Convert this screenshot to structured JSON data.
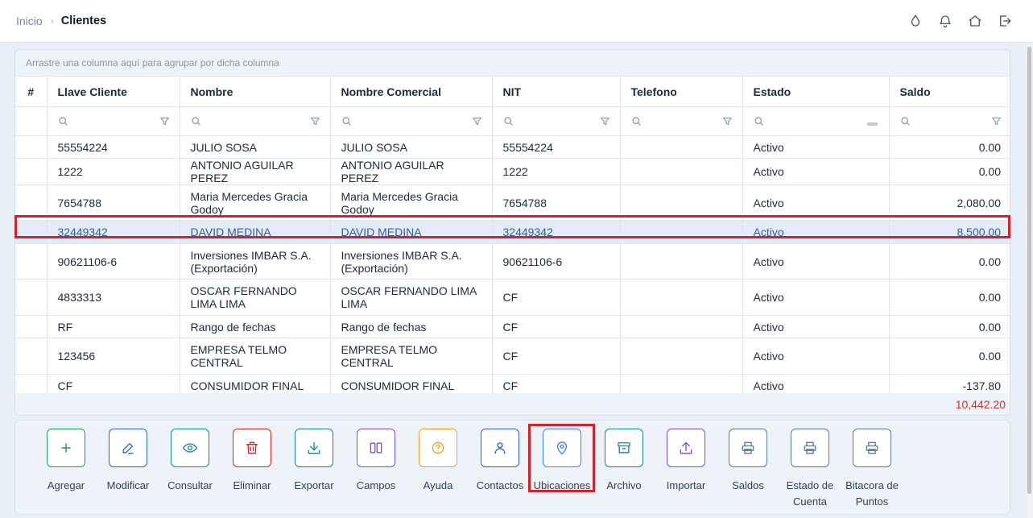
{
  "breadcrumb": {
    "home": "Inicio",
    "separator": "›",
    "current": "Clientes"
  },
  "header_icons": [
    "drop-icon",
    "bell-icon",
    "home-icon",
    "logout-icon"
  ],
  "grid": {
    "group_hint": "Arrastre una columna aquí para agrupar por dicha columna",
    "columns": [
      "#",
      "Llave Cliente",
      "Nombre",
      "Nombre Comercial",
      "NIT",
      "Telefono",
      "Estado",
      "Saldo"
    ],
    "rows": [
      {
        "llave": "55554224",
        "nombre": "JULIO SOSA",
        "comercial": "JULIO SOSA",
        "nit": "55554224",
        "telefono": "",
        "estado": "Activo",
        "saldo": "0.00"
      },
      {
        "llave": "1222",
        "nombre": "ANTONIO AGUILAR PEREZ",
        "comercial": "ANTONIO AGUILAR PEREZ",
        "nit": "1222",
        "telefono": "",
        "estado": "Activo",
        "saldo": "0.00"
      },
      {
        "llave": "7654788",
        "nombre": "Maria Mercedes Gracia Godoy",
        "comercial": "Maria Mercedes Gracia Godoy",
        "nit": "7654788",
        "telefono": "",
        "estado": "Activo",
        "saldo": "2,080.00"
      },
      {
        "llave": "32449342",
        "nombre": "DAVID MEDINA",
        "comercial": "DAVID MEDINA",
        "nit": "32449342",
        "telefono": "",
        "estado": "Activo",
        "saldo": "8,500.00",
        "selected": true
      },
      {
        "llave": "90621106-6",
        "nombre": "Inversiones IMBAR S.A. (Exportación)",
        "comercial": "Inversiones IMBAR S.A. (Exportación)",
        "nit": "90621106-6",
        "telefono": "",
        "estado": "Activo",
        "saldo": "0.00"
      },
      {
        "llave": "4833313",
        "nombre": "OSCAR FERNANDO LIMA LIMA",
        "comercial": "OSCAR FERNANDO LIMA LIMA",
        "nit": "CF",
        "telefono": "",
        "estado": "Activo",
        "saldo": "0.00"
      },
      {
        "llave": "RF",
        "nombre": "Rango de fechas",
        "comercial": "Rango de fechas",
        "nit": "CF",
        "telefono": "",
        "estado": "Activo",
        "saldo": "0.00"
      },
      {
        "llave": "123456",
        "nombre": "EMPRESA TELMO CENTRAL",
        "comercial": "EMPRESA TELMO CENTRAL",
        "nit": "CF",
        "telefono": "",
        "estado": "Activo",
        "saldo": "0.00"
      },
      {
        "llave": "CF",
        "nombre": "CONSUMIDOR FINAL",
        "comercial": "CONSUMIDOR FINAL",
        "nit": "CF",
        "telefono": "",
        "estado": "Activo",
        "saldo": "-137.80"
      }
    ],
    "total_saldo": "10,442.20"
  },
  "toolbar": [
    {
      "id": "agregar",
      "label": "Agregar",
      "icon": "plus-icon",
      "color": "#1f9d55"
    },
    {
      "id": "modificar",
      "label": "Modificar",
      "icon": "pencil-icon",
      "color": "#2f62c9"
    },
    {
      "id": "consultar",
      "label": "Consultar",
      "icon": "eye-icon",
      "color": "#14868c"
    },
    {
      "id": "eliminar",
      "label": "Eliminar",
      "icon": "trash-icon",
      "color": "#d3222a"
    },
    {
      "id": "exportar",
      "label": "Exportar",
      "icon": "download-icon",
      "color": "#14868c"
    },
    {
      "id": "campos",
      "label": "Campos",
      "icon": "columns-icon",
      "color": "#7c4ddb"
    },
    {
      "id": "ayuda",
      "label": "Ayuda",
      "icon": "help-icon",
      "color": "#f0a020"
    },
    {
      "id": "contactos",
      "label": "Contactos",
      "icon": "user-icon",
      "color": "#2f62c9"
    },
    {
      "id": "ubicaciones",
      "label": "Ubicaciones",
      "icon": "map-pin-icon",
      "color": "#3b82f6"
    },
    {
      "id": "archivo",
      "label": "Archivo",
      "icon": "archive-icon",
      "color": "#14868c"
    },
    {
      "id": "importar",
      "label": "Importar",
      "icon": "upload-icon",
      "color": "#7c4ddb"
    },
    {
      "id": "saldos",
      "label": "Saldos",
      "icon": "printer-icon",
      "color": "#5b7a99"
    },
    {
      "id": "estado_cuenta",
      "label": "Estado de Cuenta",
      "icon": "printer-icon",
      "color": "#5b7a99"
    },
    {
      "id": "bitacora",
      "label": "Bitacora de Puntos",
      "icon": "printer-icon",
      "color": "#5b7a99"
    }
  ]
}
